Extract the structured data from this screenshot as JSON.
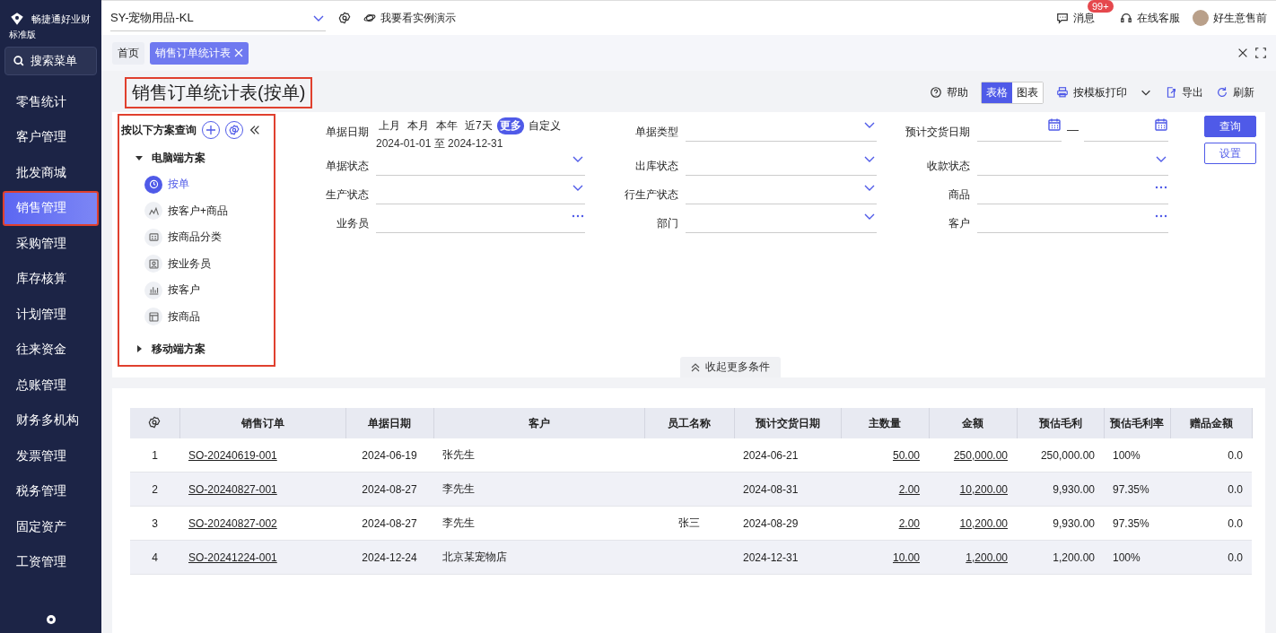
{
  "sidebar": {
    "brand": "畅捷通好业财",
    "edition": "标准版",
    "search": "搜索菜单",
    "items": [
      {
        "label": "零售统计",
        "selected": false,
        "highlighted": false
      },
      {
        "label": "客户管理",
        "selected": false,
        "highlighted": false
      },
      {
        "label": "批发商城",
        "selected": false,
        "highlighted": false
      },
      {
        "label": "销售管理",
        "selected": true,
        "highlighted": true
      },
      {
        "label": "采购管理",
        "selected": false,
        "highlighted": false
      },
      {
        "label": "库存核算",
        "selected": false,
        "highlighted": false
      },
      {
        "label": "计划管理",
        "selected": false,
        "highlighted": false
      },
      {
        "label": "往来资金",
        "selected": false,
        "highlighted": false
      },
      {
        "label": "总账管理",
        "selected": false,
        "highlighted": false
      },
      {
        "label": "财务多机构",
        "selected": false,
        "highlighted": false
      },
      {
        "label": "发票管理",
        "selected": false,
        "highlighted": false
      },
      {
        "label": "税务管理",
        "selected": false,
        "highlighted": false
      },
      {
        "label": "固定资产",
        "selected": false,
        "highlighted": false
      },
      {
        "label": "工资管理",
        "selected": false,
        "highlighted": false
      }
    ]
  },
  "topbar": {
    "account": "SY-宠物用品-KL",
    "demo": "我要看实例演示",
    "messages": "消息",
    "badge": "99+",
    "service": "在线客服",
    "user": "好生意售前"
  },
  "tabs": [
    {
      "label": "首页",
      "selected": false,
      "closable": false
    },
    {
      "label": "销售订单统计表",
      "selected": true,
      "closable": true
    }
  ],
  "page": {
    "title": "销售订单统计表(按单)",
    "title_highlighted": true,
    "toolbar": {
      "help": "帮助",
      "views": [
        {
          "label": "表格",
          "selected": true
        },
        {
          "label": "图表",
          "selected": false
        }
      ],
      "print": "按模板打印",
      "export": "导出",
      "refresh": "刷新"
    }
  },
  "schemes": {
    "title": "按以下方案查询",
    "highlighted": true,
    "groups": [
      {
        "label": "电脑端方案",
        "expanded": true,
        "children": [
          {
            "label": "按单",
            "selected": true,
            "kind": "clock"
          },
          {
            "label": "按客户+商品",
            "selected": false,
            "kind": "line"
          },
          {
            "label": "按商品分类",
            "selected": false,
            "kind": "card"
          },
          {
            "label": "按业务员",
            "selected": false,
            "kind": "person"
          },
          {
            "label": "按客户",
            "selected": false,
            "kind": "bar"
          },
          {
            "label": "按商品",
            "selected": false,
            "kind": "layout"
          }
        ]
      },
      {
        "label": "移动端方案",
        "expanded": false
      }
    ]
  },
  "filters": {
    "fields": [
      {
        "label": "单据日期",
        "kind": "date",
        "chips": [
          {
            "label": "上月",
            "selected": false
          },
          {
            "label": "本月",
            "selected": false
          },
          {
            "label": "本年",
            "selected": false
          },
          {
            "label": "近7天",
            "selected": false
          },
          {
            "label": "更多",
            "selected": true
          },
          {
            "label": "自定义",
            "selected": false
          }
        ],
        "value": "2024-01-01 至 2024-12-31"
      },
      {
        "label": "单据类型",
        "kind": "select"
      },
      {
        "label": "预计交货日期",
        "kind": "range",
        "separator": "—"
      },
      {
        "label": "单据状态",
        "kind": "select"
      },
      {
        "label": "出库状态",
        "kind": "select"
      },
      {
        "label": "收款状态",
        "kind": "select"
      },
      {
        "label": "生产状态",
        "kind": "select"
      },
      {
        "label": "行生产状态",
        "kind": "select"
      },
      {
        "label": "商品",
        "kind": "lookup"
      },
      {
        "label": "业务员",
        "kind": "lookup"
      },
      {
        "label": "部门",
        "kind": "select"
      },
      {
        "label": "客户",
        "kind": "lookup"
      }
    ],
    "query": "查询",
    "settings": "设置",
    "collapse": "收起更多条件"
  },
  "table": {
    "columns": [
      {
        "label": "销售订单",
        "link": true
      },
      {
        "label": "单据日期",
        "link": false
      },
      {
        "label": "客户",
        "link": false
      },
      {
        "label": "员工名称",
        "link": false
      },
      {
        "label": "预计交货日期",
        "link": false
      },
      {
        "label": "主数量",
        "link": true
      },
      {
        "label": "金额",
        "link": true
      },
      {
        "label": "预估毛利",
        "link": false
      },
      {
        "label": "预估毛利率",
        "link": false
      },
      {
        "label": "赠品金额",
        "link": false
      }
    ],
    "rows": [
      {
        "index": "1",
        "cells": [
          "SO-20240619-001",
          "2024-06-19",
          "张先生",
          "",
          "2024-06-21",
          "50.00",
          "250,000.00",
          "250,000.00",
          "100%",
          "0.0"
        ]
      },
      {
        "index": "2",
        "cells": [
          "SO-20240827-001",
          "2024-08-27",
          "李先生",
          "",
          "2024-08-31",
          "2.00",
          "10,200.00",
          "9,930.00",
          "97.35%",
          "0.0"
        ]
      },
      {
        "index": "3",
        "cells": [
          "SO-20240827-002",
          "2024-08-27",
          "李先生",
          "张三",
          "2024-08-29",
          "2.00",
          "10,200.00",
          "9,930.00",
          "97.35%",
          "0.0"
        ]
      },
      {
        "index": "4",
        "cells": [
          "SO-20241224-001",
          "2024-12-24",
          "北京某宠物店",
          "",
          "2024-12-31",
          "10.00",
          "1,200.00",
          "1,200.00",
          "100%",
          "0.0"
        ]
      }
    ]
  }
}
